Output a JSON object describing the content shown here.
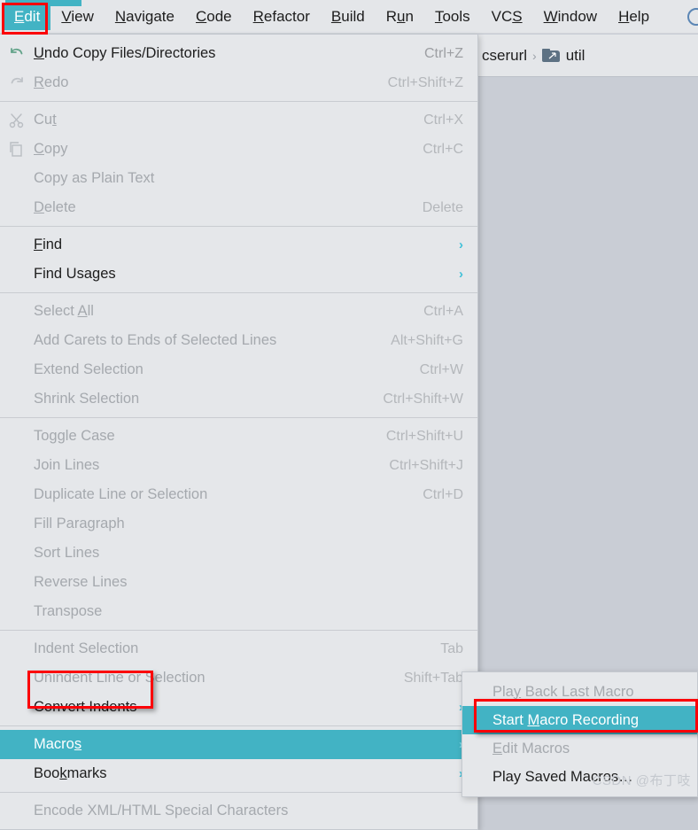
{
  "menubar": {
    "items": [
      {
        "label": "Edit",
        "mnemonic": "E",
        "active": true
      },
      {
        "label": "View",
        "mnemonic": "V",
        "active": false
      },
      {
        "label": "Navigate",
        "mnemonic": "N",
        "active": false
      },
      {
        "label": "Code",
        "mnemonic": "C",
        "active": false
      },
      {
        "label": "Refactor",
        "mnemonic": "R",
        "active": false
      },
      {
        "label": "Build",
        "mnemonic": "B",
        "active": false
      },
      {
        "label": "Run",
        "mnemonic": "u",
        "active": false
      },
      {
        "label": "Tools",
        "mnemonic": "T",
        "active": false
      },
      {
        "label": "VCS",
        "mnemonic": "S",
        "active": false
      },
      {
        "label": "Window",
        "mnemonic": "W",
        "active": false
      },
      {
        "label": "Help",
        "mnemonic": "H",
        "active": false
      }
    ],
    "right_icon": "search-circle-icon"
  },
  "breadcrumb": {
    "items": [
      {
        "label": "cserurl",
        "icon": null
      },
      {
        "label": "util",
        "icon": "folder-icon"
      }
    ],
    "separator": "›"
  },
  "edit_menu": {
    "groups": [
      {
        "items": [
          {
            "label": "Undo Copy Files/Directories",
            "mnemonic": "U",
            "accel": "Ctrl+Z",
            "disabled": false,
            "icon": "undo-icon",
            "submenu": false
          },
          {
            "label": "Redo",
            "mnemonic": "R",
            "accel": "Ctrl+Shift+Z",
            "disabled": true,
            "icon": "redo-icon",
            "submenu": false
          }
        ]
      },
      {
        "items": [
          {
            "label": "Cut",
            "mnemonic": "t",
            "accel": "Ctrl+X",
            "disabled": true,
            "icon": "scissors-icon",
            "submenu": false
          },
          {
            "label": "Copy",
            "mnemonic": "C",
            "accel": "Ctrl+C",
            "disabled": true,
            "icon": "copy-icon",
            "submenu": false
          },
          {
            "label": "Copy as Plain Text",
            "mnemonic": "",
            "accel": "",
            "disabled": true,
            "icon": null,
            "submenu": false
          },
          {
            "label": "Delete",
            "mnemonic": "D",
            "accel": "Delete",
            "disabled": true,
            "icon": null,
            "submenu": false
          }
        ]
      },
      {
        "items": [
          {
            "label": "Find",
            "mnemonic": "F",
            "accel": "",
            "disabled": false,
            "icon": null,
            "submenu": true
          },
          {
            "label": "Find Usages",
            "mnemonic": "",
            "accel": "",
            "disabled": false,
            "icon": null,
            "submenu": true
          }
        ]
      },
      {
        "items": [
          {
            "label": "Select All",
            "mnemonic": "A",
            "accel": "Ctrl+A",
            "disabled": true,
            "icon": null,
            "submenu": false
          },
          {
            "label": "Add Carets to Ends of Selected Lines",
            "mnemonic": "",
            "accel": "Alt+Shift+G",
            "disabled": true,
            "icon": null,
            "submenu": false
          },
          {
            "label": "Extend Selection",
            "mnemonic": "",
            "accel": "Ctrl+W",
            "disabled": true,
            "icon": null,
            "submenu": false
          },
          {
            "label": "Shrink Selection",
            "mnemonic": "",
            "accel": "Ctrl+Shift+W",
            "disabled": true,
            "icon": null,
            "submenu": false
          }
        ]
      },
      {
        "items": [
          {
            "label": "Toggle Case",
            "mnemonic": "",
            "accel": "Ctrl+Shift+U",
            "disabled": true,
            "icon": null,
            "submenu": false
          },
          {
            "label": "Join Lines",
            "mnemonic": "",
            "accel": "Ctrl+Shift+J",
            "disabled": true,
            "icon": null,
            "submenu": false
          },
          {
            "label": "Duplicate Line or Selection",
            "mnemonic": "",
            "accel": "Ctrl+D",
            "disabled": true,
            "icon": null,
            "submenu": false
          },
          {
            "label": "Fill Paragraph",
            "mnemonic": "",
            "accel": "",
            "disabled": true,
            "icon": null,
            "submenu": false
          },
          {
            "label": "Sort Lines",
            "mnemonic": "",
            "accel": "",
            "disabled": true,
            "icon": null,
            "submenu": false
          },
          {
            "label": "Reverse Lines",
            "mnemonic": "",
            "accel": "",
            "disabled": true,
            "icon": null,
            "submenu": false
          },
          {
            "label": "Transpose",
            "mnemonic": "",
            "accel": "",
            "disabled": true,
            "icon": null,
            "submenu": false
          }
        ]
      },
      {
        "items": [
          {
            "label": "Indent Selection",
            "mnemonic": "",
            "accel": "Tab",
            "disabled": true,
            "icon": null,
            "submenu": false
          },
          {
            "label": "Unindent Line or Selection",
            "mnemonic": "",
            "accel": "Shift+Tab",
            "disabled": true,
            "icon": null,
            "submenu": false
          },
          {
            "label": "Convert Indents",
            "mnemonic": "",
            "accel": "",
            "disabled": false,
            "icon": null,
            "submenu": true
          }
        ]
      },
      {
        "items": [
          {
            "label": "Macros",
            "mnemonic": "s",
            "accel": "",
            "disabled": false,
            "icon": null,
            "submenu": true,
            "selected": true
          },
          {
            "label": "Bookmarks",
            "mnemonic": "k",
            "accel": "",
            "disabled": false,
            "icon": null,
            "submenu": true
          }
        ]
      },
      {
        "items": [
          {
            "label": "Encode XML/HTML Special Characters",
            "mnemonic": "",
            "accel": "",
            "disabled": true,
            "icon": null,
            "submenu": false
          }
        ]
      }
    ]
  },
  "macros_submenu": {
    "items": [
      {
        "label": "Play Back Last Macro",
        "mnemonic": "y",
        "disabled": true,
        "selected": false
      },
      {
        "label": "Start Macro Recording",
        "mnemonic": "M",
        "disabled": false,
        "selected": true
      },
      {
        "label": "Edit Macros",
        "mnemonic": "E",
        "disabled": true,
        "selected": false
      },
      {
        "label": "Play Saved Macros…",
        "mnemonic": "",
        "disabled": false,
        "selected": false
      }
    ]
  },
  "annotations": {
    "color": "#fb0007",
    "targets": [
      "Edit",
      "Macros",
      "Start Macro Recording"
    ]
  },
  "watermark": {
    "text": "CSDN @布丁吱"
  },
  "colors": {
    "highlight": "#42b3c4",
    "menu_bg": "#e5e7ea",
    "app_bg": "#c9cdd5",
    "annotation": "#fb0007",
    "submenu_arrow": "#3fc0d8"
  }
}
